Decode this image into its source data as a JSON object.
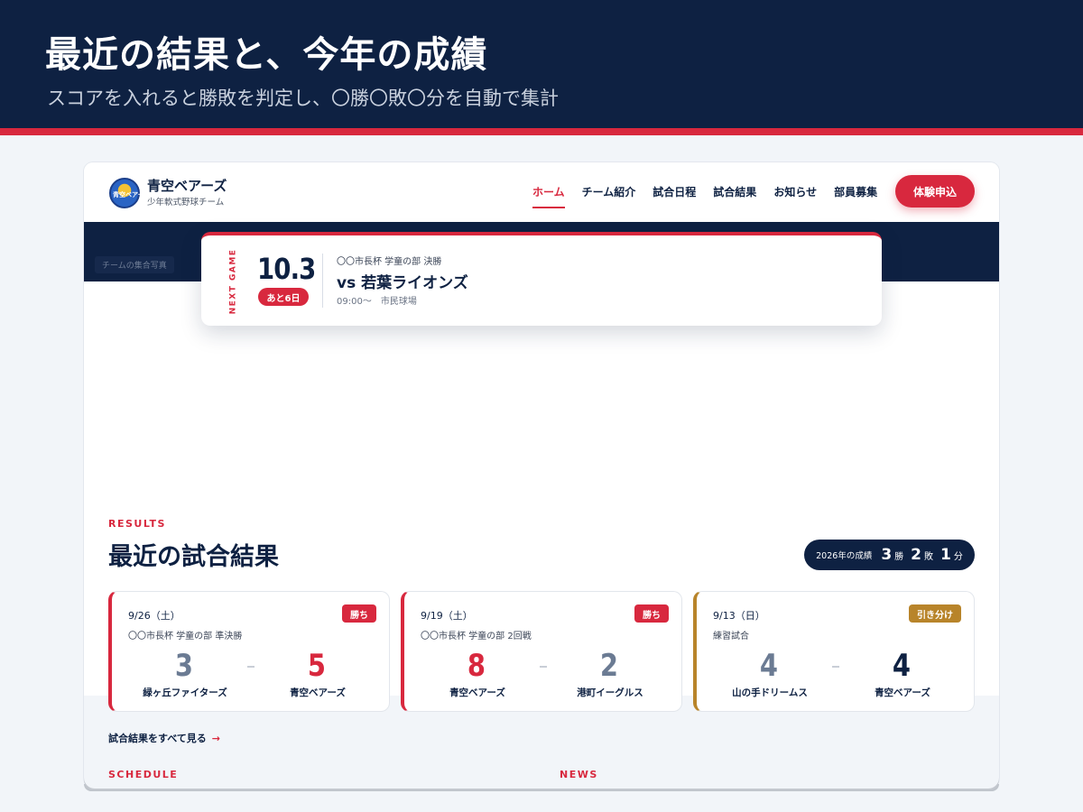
{
  "banner": {
    "title": "最近の結果と、今年の成績",
    "subtitle": "スコアを入れると勝敗を判定し、〇勝〇敗〇分を自動で集計"
  },
  "nav": {
    "brand_name": "青空ベアーズ",
    "brand_sub": "少年軟式野球チーム",
    "logo_text": "青空ベアーズ",
    "links": [
      {
        "label": "ホーム",
        "active": true
      },
      {
        "label": "チーム紹介"
      },
      {
        "label": "試合日程"
      },
      {
        "label": "試合結果"
      },
      {
        "label": "お知らせ"
      },
      {
        "label": "部員募集"
      }
    ],
    "cta": "体験申込"
  },
  "hero": {
    "photo_label": "チームの集合写真"
  },
  "next_game": {
    "label": "NEXT GAME",
    "date": "10.3",
    "countdown": "あと6日",
    "competition": "〇〇市長杯 学童の部 決勝",
    "opponent": "vs 若葉ライオンズ",
    "meta": "09:00〜　市民球場"
  },
  "results": {
    "eyebrow": "RESULTS",
    "title": "最近の試合結果",
    "record": {
      "label": "2026年の成績",
      "wins": "3",
      "wins_unit": "勝",
      "losses": "2",
      "losses_unit": "敗",
      "draws": "1",
      "draws_unit": "分"
    },
    "cards": [
      {
        "date": "9/26（土）",
        "competition": "〇〇市長杯 学童の部 準決勝",
        "badge": "勝ち",
        "home_score": "3",
        "home_team": "緑ヶ丘ファイターズ",
        "away_score": "5",
        "away_team": "青空ベアーズ"
      },
      {
        "date": "9/19（土）",
        "competition": "〇〇市長杯 学童の部 2回戦",
        "badge": "勝ち",
        "home_score": "8",
        "home_team": "青空ベアーズ",
        "away_score": "2",
        "away_team": "港町イーグルス"
      },
      {
        "date": "9/13（日）",
        "competition": "練習試合",
        "badge": "引き分け",
        "home_score": "4",
        "home_team": "山の手ドリームス",
        "away_score": "4",
        "away_team": "青空ベアーズ"
      }
    ],
    "all_link": "試合結果をすべて見る",
    "all_link_arrow": "→"
  },
  "lower": {
    "schedule_eyebrow": "SCHEDULE",
    "news_eyebrow": "NEWS"
  },
  "colors": {
    "navy": "#0e2142",
    "accent_red": "#d8283e",
    "draw_gold": "#b8842a",
    "loss_gray": "#6b7b93"
  },
  "icons": {
    "arrow": "arrow-right-icon",
    "logo": "bear-logo-icon"
  }
}
